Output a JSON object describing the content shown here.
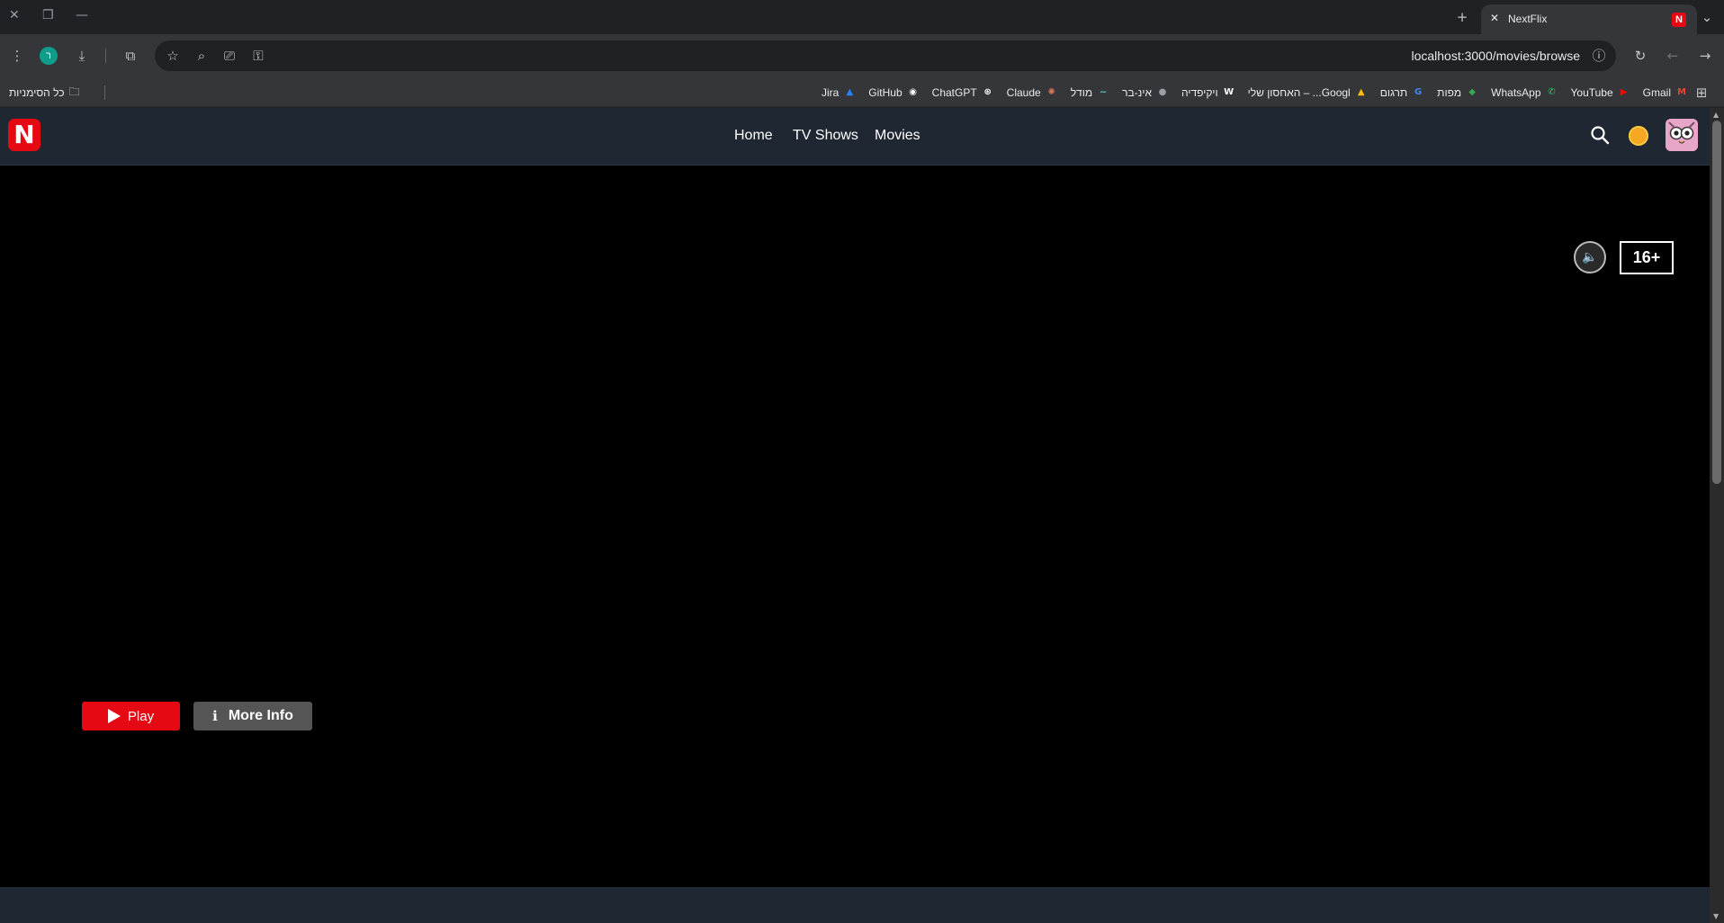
{
  "browser": {
    "tab": {
      "title": "NextFlix",
      "close_glyph": "✕",
      "favicon": "N"
    },
    "new_tab_glyph": "+",
    "tab_search_glyph": "⌄",
    "url": "localhost:3000/movies/browse",
    "profile_initial": "ר",
    "bookmarks": [
      {
        "label": "Gmail",
        "icon": "gmail-icon",
        "color": "#ea4335",
        "glyph": "M"
      },
      {
        "label": "YouTube",
        "icon": "youtube-icon",
        "color": "#ff0000",
        "glyph": "▶"
      },
      {
        "label": "WhatsApp",
        "icon": "whatsapp-icon",
        "color": "#25d366",
        "glyph": "✆"
      },
      {
        "label": "מפות",
        "icon": "maps-icon",
        "color": "#34a853",
        "glyph": "◆"
      },
      {
        "label": "תרגום",
        "icon": "translate-icon",
        "color": "#4285f4",
        "glyph": "G"
      },
      {
        "label": "האחסון שלי – ...Googl",
        "icon": "drive-icon",
        "color": "#fbbc04",
        "glyph": "▲"
      },
      {
        "label": "ויקיפדיה",
        "icon": "wikipedia-icon",
        "color": "#ffffff",
        "glyph": "W"
      },
      {
        "label": "אינ-בר",
        "icon": "globe-icon",
        "color": "#9aa0a6",
        "glyph": "●"
      },
      {
        "label": "מודל",
        "icon": "moodle-icon",
        "color": "#4dd0c4",
        "glyph": "~"
      },
      {
        "label": "Claude",
        "icon": "claude-icon",
        "color": "#d97757",
        "glyph": "✺"
      },
      {
        "label": "ChatGPT",
        "icon": "chatgpt-icon",
        "color": "#ffffff",
        "glyph": "⊛"
      },
      {
        "label": "GitHub",
        "icon": "github-icon",
        "color": "#ffffff",
        "glyph": "◉"
      },
      {
        "label": "Jira",
        "icon": "jira-icon",
        "color": "#2684ff",
        "glyph": "▲"
      }
    ],
    "all_bookmarks_label": "כל הסימניות"
  },
  "site": {
    "logo": "N",
    "nav": {
      "home": "Home",
      "tv_shows": "TV Shows",
      "movies": "Movies"
    },
    "rating": "16+",
    "mute_glyph": "🔈",
    "play_label": "Play",
    "more_info_label": "More Info",
    "info_glyph": "i",
    "colors": {
      "brand": "#e50914",
      "navbar": "#1f2733",
      "hero": "#000000"
    }
  }
}
